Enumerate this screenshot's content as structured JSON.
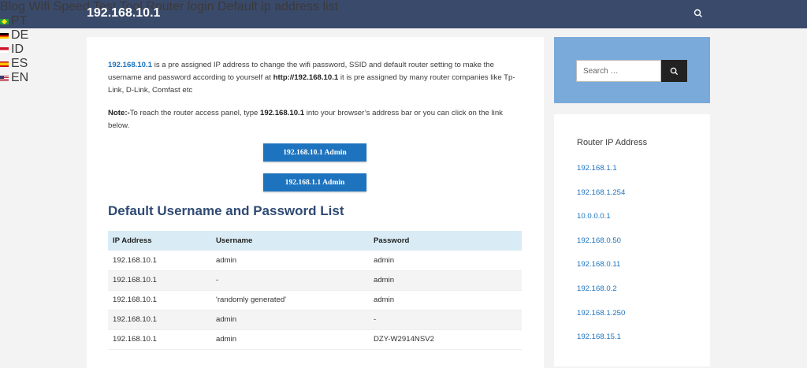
{
  "header": {
    "site_title": "192.168.10.1",
    "nav": [
      "Blog",
      "Wifi Speed Test Tool",
      "Router login",
      "Default ip address list"
    ],
    "languages": [
      "PT",
      "DE",
      "ID",
      "ES",
      "EN"
    ],
    "colors": {
      "bar": "#3a4a6b",
      "link": "#1e73be",
      "heading": "#2f4a73"
    }
  },
  "intro": {
    "ip": "192.168.10.1",
    "text1": " is a pre assigned IP address to change the wifi password, SSID and default router setting to make the username and password according to yourself at ",
    "url": "http://192.168.10.1",
    "text2": " it is pre assigned by many router companies like Tp-Link, D-Link, Comfast etc"
  },
  "note": {
    "label": "Note:-",
    "text1": "To reach the router access panel, type ",
    "ip": "192.168.10.1",
    "text2": " into your browser’s address bar or you can click on the link below."
  },
  "buttons": [
    "192.168.10.1 Admin",
    "192.168.1.1 Admin"
  ],
  "section_heading": "Default Username and Password List",
  "table": {
    "headers": [
      "IP Address",
      "Username",
      "Password"
    ],
    "rows": [
      [
        "192.168.10.1",
        "admin",
        "admin"
      ],
      [
        "192.168.10.1",
        "-",
        "admin"
      ],
      [
        "192.168.10.1",
        "'randomly generated'",
        "admin"
      ],
      [
        "192.168.10.1",
        "admin",
        "-"
      ],
      [
        "192.168.10.1",
        "admin",
        "DZY-W2914NSV2"
      ]
    ]
  },
  "sidebar": {
    "search_placeholder": "Search …",
    "heading": "Router IP Address",
    "links": [
      "192.168.1.1",
      "192.168.1.254",
      "10.0.0.0.1",
      "192.168.0.50",
      "192.168.0.11",
      "192.168.0.2",
      "192.168.1.250",
      "192.168.15.1"
    ]
  }
}
